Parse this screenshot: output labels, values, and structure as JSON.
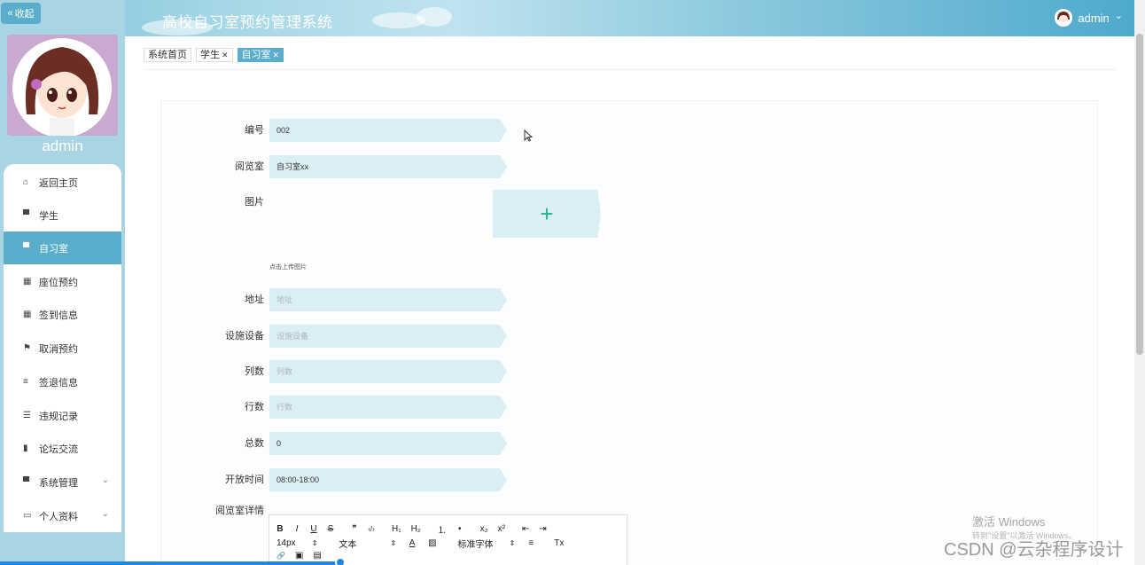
{
  "app": {
    "title": "高校自习室预约管理系统"
  },
  "header": {
    "user": "admin",
    "user_caret": "⌄"
  },
  "sidebar": {
    "collapse_label": "收起",
    "collapse_icon": "«",
    "username": "admin",
    "items": [
      {
        "label": "返回主页",
        "icon": "home-icon",
        "glyph": "⌂"
      },
      {
        "label": "学生",
        "icon": "student-icon",
        "glyph": "▀"
      },
      {
        "label": "自习室",
        "icon": "room-icon",
        "glyph": "▀"
      },
      {
        "label": "座位预约",
        "icon": "grid-icon",
        "glyph": "▦"
      },
      {
        "label": "签到信息",
        "icon": "grid-icon",
        "glyph": "▦"
      },
      {
        "label": "取消预约",
        "icon": "flag-icon",
        "glyph": "⚑"
      },
      {
        "label": "签退信息",
        "icon": "list-icon",
        "glyph": "≡"
      },
      {
        "label": "违规记录",
        "icon": "sliders-icon",
        "glyph": "☰"
      },
      {
        "label": "论坛交流",
        "icon": "bar-chart-icon",
        "glyph": "▮"
      },
      {
        "label": "系统管理",
        "icon": "system-icon",
        "glyph": "▀",
        "caret": "⌄"
      },
      {
        "label": "个人资料",
        "icon": "profile-icon",
        "glyph": "▭",
        "caret": "⌄"
      }
    ]
  },
  "tabs": [
    {
      "label": "系统首页",
      "close": ""
    },
    {
      "label": "学生",
      "close": "✕"
    },
    {
      "label": "自习室",
      "close": "✕"
    }
  ],
  "form": {
    "fields": {
      "code": {
        "label": "编号",
        "value": "002"
      },
      "room": {
        "label": "阅览室",
        "value": "自习室xx"
      },
      "image": {
        "label": "图片",
        "upload_symbol": "+",
        "hint": "点击上传图片"
      },
      "address": {
        "label": "地址",
        "placeholder": "地址"
      },
      "facilities": {
        "label": "设施设备",
        "placeholder": "设施设备"
      },
      "cols": {
        "label": "列数",
        "placeholder": "列数"
      },
      "rows": {
        "label": "行数",
        "placeholder": "行数"
      },
      "total": {
        "label": "总数",
        "value": "0"
      },
      "hours": {
        "label": "开放时间",
        "value": "08:00-18:00"
      },
      "detail": {
        "label": "阅览室详情"
      }
    },
    "editor": {
      "row1": [
        "B",
        "I",
        "U",
        "S",
        "❞",
        "‹/›",
        "H₁",
        "H₂",
        "⒈",
        "•",
        "x₂",
        "x²",
        "⇤",
        "⇥"
      ],
      "font_size": "14px",
      "text_style": "文本",
      "font_family": "标准字体",
      "row2_tail": [
        "A",
        "▨",
        "≡",
        "Tx"
      ],
      "row3": [
        "🔗",
        "▣",
        "▤"
      ]
    }
  },
  "watermark": {
    "title": "激活 Windows",
    "sub": "转到\"设置\"以激活 Windows。",
    "csdn": "CSDN @云杂程序设计"
  },
  "colors": {
    "accent": "#5aaecb",
    "input_bg": "#dbeef4",
    "plus": "#28b28a"
  }
}
